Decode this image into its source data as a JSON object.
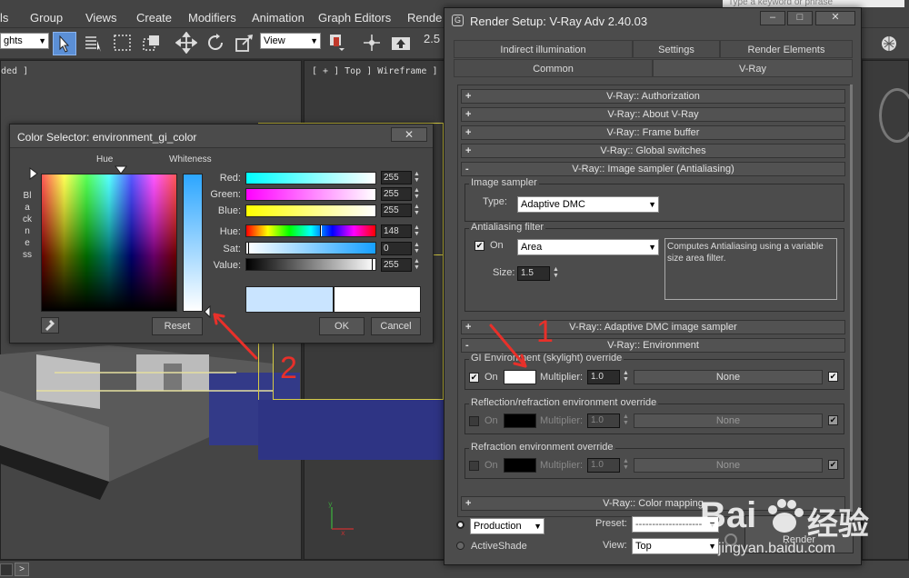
{
  "menubar": {
    "items": [
      "ls",
      "Group",
      "Views",
      "Create",
      "Modifiers",
      "Animation",
      "Graph Editors",
      "Rende"
    ],
    "search_placeholder": "Type a keyword or phrase"
  },
  "toolbar": {
    "selection_filter": "ghts",
    "coord_system": "View",
    "spinner_label": "2.5"
  },
  "viewports": {
    "left_label": "ded ]",
    "top_label": "[ + ] Top ] Wireframe ]"
  },
  "statusbar": {
    "play_label": ">"
  },
  "color_selector": {
    "title": "Color Selector: environment_gi_color",
    "close_label": "✕",
    "hue_header": "Hue",
    "whiteness_header": "Whiteness",
    "blackness_label": "Blackness",
    "sliders": [
      {
        "label": "Red:",
        "value": "255"
      },
      {
        "label": "Green:",
        "value": "255"
      },
      {
        "label": "Blue:",
        "value": "255"
      },
      {
        "label": "Hue:",
        "value": "148"
      },
      {
        "label": "Sat:",
        "value": "0"
      },
      {
        "label": "Value:",
        "value": "255"
      }
    ],
    "reset_label": "Reset",
    "ok_label": "OK",
    "cancel_label": "Cancel",
    "old_color": "#c9e4ff",
    "new_color": "#ffffff"
  },
  "render_setup": {
    "title": "Render Setup: V-Ray Adv 2.40.03",
    "tabs_row1": [
      "Indirect illumination",
      "Settings",
      "Render Elements"
    ],
    "tabs_row2": [
      "Common",
      "V-Ray"
    ],
    "rollouts": {
      "authorization": "V-Ray:: Authorization",
      "about": "V-Ray:: About V-Ray",
      "frame_buffer": "V-Ray:: Frame buffer",
      "global_switches": "V-Ray:: Global switches",
      "image_sampler": "V-Ray:: Image sampler (Antialiasing)",
      "adaptive_dmc": "V-Ray:: Adaptive DMC image sampler",
      "environment": "V-Ray:: Environment",
      "color_mapping": "V-Ray:: Color mapping"
    },
    "image_sampler": {
      "group_label": "Image sampler",
      "type_label": "Type:",
      "type_value": "Adaptive DMC"
    },
    "aa_filter": {
      "group_label": "Antialiasing filter",
      "on_label": "On",
      "filter_value": "Area",
      "description": "Computes Antialiasing using a variable size area filter.",
      "size_label": "Size:",
      "size_value": "1.5"
    },
    "environment": {
      "gi_label": "GI Environment (skylight) override",
      "refl_label": "Reflection/refraction environment override",
      "refr_label": "Refraction environment override",
      "on_label": "On",
      "multiplier_label": "Multiplier:",
      "multiplier_value": "1.0",
      "map_none": "None",
      "gi_color": "#ffffff",
      "off_color": "#000000"
    },
    "bottom": {
      "production": "Production",
      "activeshade": "ActiveShade",
      "preset_label": "Preset:",
      "preset_value": "--------------------",
      "view_label": "View:",
      "view_value": "Top",
      "render_label": "Render"
    }
  },
  "annotations": {
    "mark1": "1",
    "mark2": "2",
    "color": "#e8302a"
  },
  "watermark": {
    "brand": "Bai",
    "brand_cn": "经验",
    "url": "jingyan.baidu.com"
  }
}
